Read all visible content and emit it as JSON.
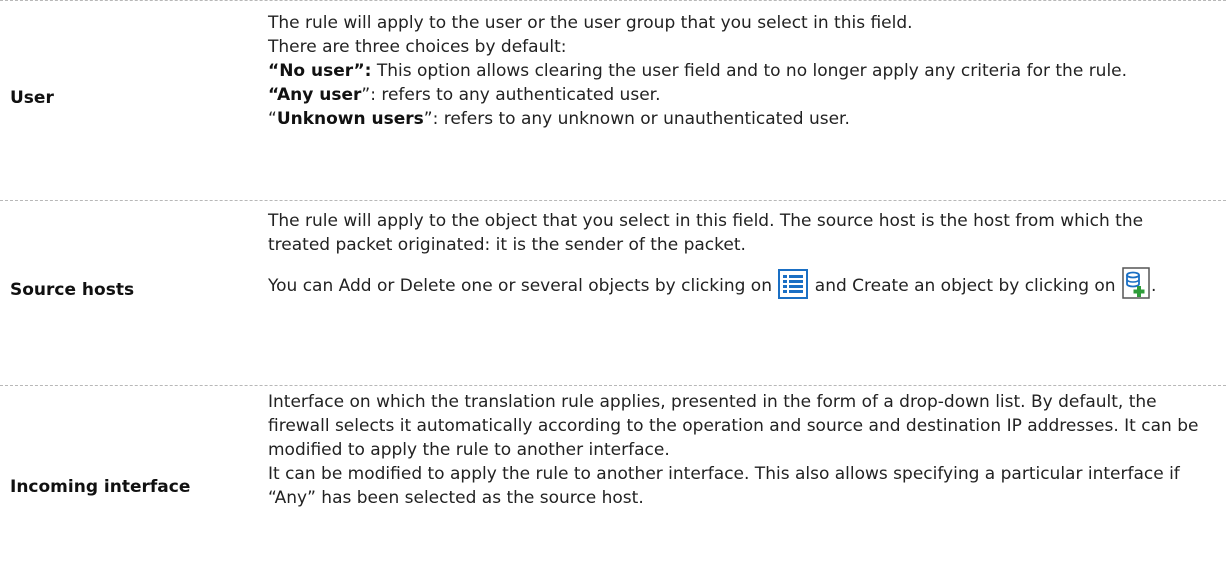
{
  "rows": [
    {
      "label": "User",
      "lines": [
        "The rule will apply to the user or the user group that you select in this field.",
        "There are three choices by default:"
      ],
      "choices": [
        {
          "open_quote": "“",
          "name": "No user”:",
          "text": " This option allows clearing the user field and to no longer apply any criteria for the rule."
        },
        {
          "open_quote": "“",
          "name": "Any user",
          "text": "”: refers to any authenticated user."
        },
        {
          "open_quote": "“",
          "name": "Unknown users",
          "text": "”: refers to any unknown or unauthenticated user."
        }
      ]
    },
    {
      "label": "Source hosts",
      "para1": "The rule will apply to the object that you select in this field. The source host is the host from which the treated packet originated: it is the sender of the packet.",
      "para2_a": "You can Add or Delete one or several objects by clicking on ",
      "para2_b": " and Create an object by clicking on ",
      "para2_c": ".",
      "icons": [
        "list-icon",
        "add-object-icon"
      ]
    },
    {
      "label": "Incoming interface",
      "para1": "Interface on which the translation rule applies, presented in the form of a drop-down list. By default, the firewall selects it automatically according to the operation and source and destination IP addresses. It can be modified to apply the rule to another interface.",
      "para2": "It can be modified to apply the rule to another interface. This also allows specifying a particular interface if “Any” has been selected as the source host."
    }
  ],
  "colors": {
    "icon_blue": "#1a6fc4",
    "icon_green": "#2e9c3a",
    "divider": "#b8b8b8"
  }
}
